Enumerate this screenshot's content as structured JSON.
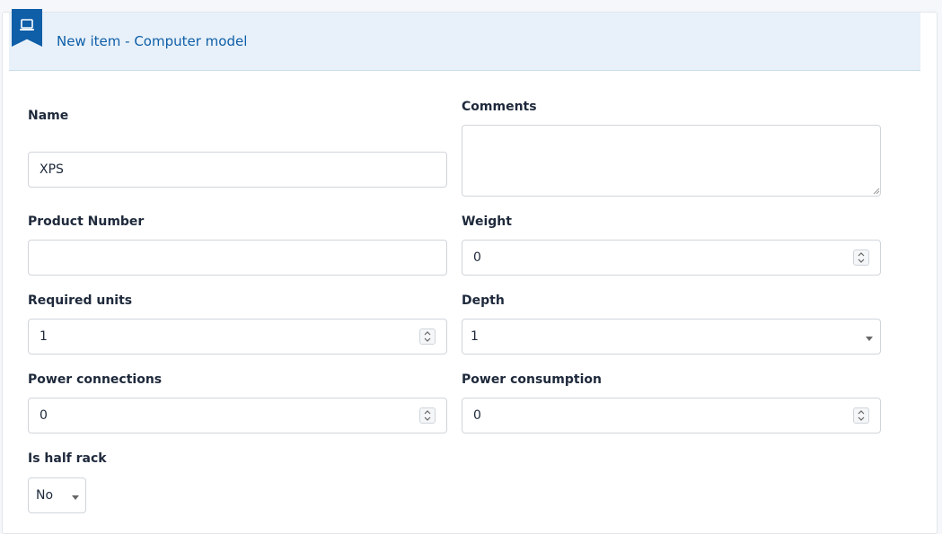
{
  "header": {
    "title": "New item - Computer model",
    "icon": "laptop-icon"
  },
  "form": {
    "name": {
      "label": "Name",
      "value": "XPS"
    },
    "comments": {
      "label": "Comments",
      "value": ""
    },
    "product_number": {
      "label": "Product Number",
      "value": ""
    },
    "weight": {
      "label": "Weight",
      "value": "0"
    },
    "required_units": {
      "label": "Required units",
      "value": "1"
    },
    "depth": {
      "label": "Depth",
      "value": "1"
    },
    "power_connections": {
      "label": "Power connections",
      "value": "0"
    },
    "power_consumption": {
      "label": "Power consumption",
      "value": "0"
    },
    "is_half_rack": {
      "label": "Is half rack",
      "value": "No"
    }
  },
  "colors": {
    "accent": "#0e5ea8",
    "header_bg": "#e8f1f9"
  }
}
